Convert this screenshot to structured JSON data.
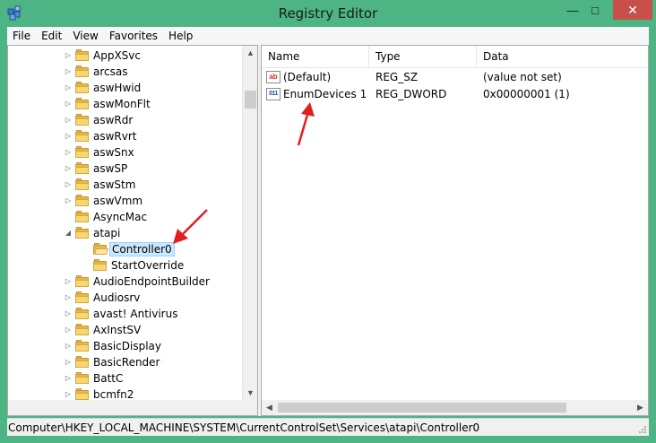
{
  "window": {
    "title": "Registry Editor",
    "minimize_glyph": "—",
    "maximize_glyph": "□",
    "close_glyph": "✕",
    "accent_color": "#4db584",
    "close_color": "#c7504b"
  },
  "menu": [
    "File",
    "Edit",
    "View",
    "Favorites",
    "Help"
  ],
  "tree": {
    "items": [
      {
        "label": "AppXSvc",
        "level": 0,
        "expander": "collapsed",
        "icon": "folder-icon"
      },
      {
        "label": "arcsas",
        "level": 0,
        "expander": "collapsed",
        "icon": "folder-icon"
      },
      {
        "label": "aswHwid",
        "level": 0,
        "expander": "collapsed",
        "icon": "folder-icon"
      },
      {
        "label": "aswMonFlt",
        "level": 0,
        "expander": "collapsed",
        "icon": "folder-icon"
      },
      {
        "label": "aswRdr",
        "level": 0,
        "expander": "collapsed",
        "icon": "folder-icon"
      },
      {
        "label": "aswRvrt",
        "level": 0,
        "expander": "collapsed",
        "icon": "folder-icon"
      },
      {
        "label": "aswSnx",
        "level": 0,
        "expander": "collapsed",
        "icon": "folder-icon"
      },
      {
        "label": "aswSP",
        "level": 0,
        "expander": "collapsed",
        "icon": "folder-icon"
      },
      {
        "label": "aswStm",
        "level": 0,
        "expander": "collapsed",
        "icon": "folder-icon"
      },
      {
        "label": "aswVmm",
        "level": 0,
        "expander": "collapsed",
        "icon": "folder-icon"
      },
      {
        "label": "AsyncMac",
        "level": 0,
        "expander": "none",
        "icon": "folder-icon"
      },
      {
        "label": "atapi",
        "level": 0,
        "expander": "expanded",
        "icon": "folder-icon"
      },
      {
        "label": "Controller0",
        "level": 1,
        "expander": "none",
        "icon": "open-folder-icon",
        "selected": true
      },
      {
        "label": "StartOverride",
        "level": 1,
        "expander": "none",
        "icon": "folder-icon"
      },
      {
        "label": "AudioEndpointBuilder",
        "level": 0,
        "expander": "collapsed",
        "icon": "folder-icon"
      },
      {
        "label": "Audiosrv",
        "level": 0,
        "expander": "collapsed",
        "icon": "folder-icon"
      },
      {
        "label": "avast! Antivirus",
        "level": 0,
        "expander": "collapsed",
        "icon": "folder-icon"
      },
      {
        "label": "AxInstSV",
        "level": 0,
        "expander": "collapsed",
        "icon": "folder-icon"
      },
      {
        "label": "BasicDisplay",
        "level": 0,
        "expander": "collapsed",
        "icon": "folder-icon"
      },
      {
        "label": "BasicRender",
        "level": 0,
        "expander": "collapsed",
        "icon": "folder-icon"
      },
      {
        "label": "BattC",
        "level": 0,
        "expander": "collapsed",
        "icon": "folder-icon"
      },
      {
        "label": "bcmfn2",
        "level": 0,
        "expander": "collapsed",
        "icon": "folder-icon"
      }
    ]
  },
  "list": {
    "columns": [
      "Name",
      "Type",
      "Data"
    ],
    "rows": [
      {
        "name": "(Default)",
        "type": "REG_SZ",
        "data": "(value not set)",
        "icon": "string-value-icon",
        "icon_text": "ab"
      },
      {
        "name": "EnumDevices 1",
        "type": "REG_DWORD",
        "data": "0x00000001 (1)",
        "icon": "dword-value-icon",
        "icon_text": "011"
      }
    ]
  },
  "statusbar": {
    "path": "Computer\\HKEY_LOCAL_MACHINE\\SYSTEM\\CurrentControlSet\\Services\\atapi\\Controller0"
  }
}
